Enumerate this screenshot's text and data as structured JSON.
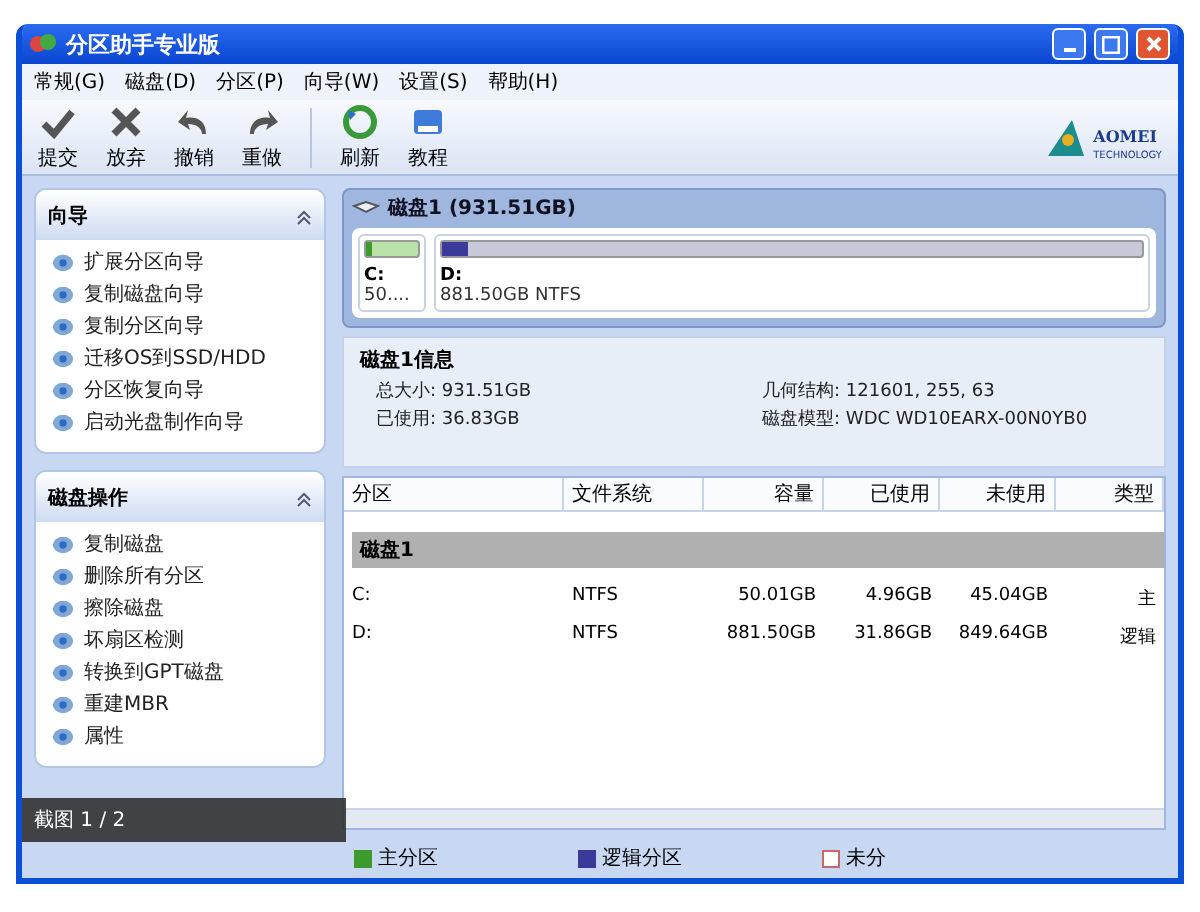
{
  "window": {
    "title": "分区助手专业版"
  },
  "menu": [
    {
      "label": "常规(G)"
    },
    {
      "label": "磁盘(D)"
    },
    {
      "label": "分区(P)"
    },
    {
      "label": "向导(W)"
    },
    {
      "label": "设置(S)"
    },
    {
      "label": "帮助(H)"
    }
  ],
  "toolbar": [
    {
      "label": "提交",
      "kind": "check"
    },
    {
      "label": "放弃",
      "kind": "cross"
    },
    {
      "label": "撤销",
      "kind": "undo"
    },
    {
      "label": "重做",
      "kind": "redo"
    },
    {
      "label": "刷新",
      "kind": "refresh"
    },
    {
      "label": "教程",
      "kind": "book"
    }
  ],
  "logo": {
    "name": "AOMEI",
    "sub": "TECHNOLOGY"
  },
  "sidebar": {
    "panels": [
      {
        "title": "向导",
        "expanded": true,
        "items": [
          {
            "label": "扩展分区向导"
          },
          {
            "label": "复制磁盘向导"
          },
          {
            "label": "复制分区向导"
          },
          {
            "label": "迁移OS到SSD/HDD"
          },
          {
            "label": "分区恢复向导"
          },
          {
            "label": "启动光盘制作向导"
          }
        ]
      },
      {
        "title": "磁盘操作",
        "expanded": true,
        "items": [
          {
            "label": "复制磁盘"
          },
          {
            "label": "删除所有分区"
          },
          {
            "label": "擦除磁盘"
          },
          {
            "label": "坏扇区检测"
          },
          {
            "label": "转换到GPT磁盘"
          },
          {
            "label": "重建MBR"
          },
          {
            "label": "属性"
          }
        ]
      }
    ]
  },
  "disk_map": {
    "title": "磁盘1 (931.51GB)",
    "partitions": [
      {
        "name": "C:",
        "detail": "50....",
        "kind": "primary",
        "level": 0.1
      },
      {
        "name": "D:",
        "detail": "881.50GB NTFS",
        "kind": "logical",
        "level": 0.036
      }
    ]
  },
  "disk_info": {
    "title": "磁盘1信息",
    "fields": [
      {
        "label": "总大小:",
        "value": "931.51GB"
      },
      {
        "label": "几何结构:",
        "value": "121601, 255, 63"
      },
      {
        "label": "已使用:",
        "value": "36.83GB"
      },
      {
        "label": "磁盘模型:",
        "value": "WDC WD10EARX-00N0YB0"
      }
    ]
  },
  "table": {
    "columns": [
      "分区",
      "文件系统",
      "容量",
      "已使用",
      "未使用",
      "类型"
    ],
    "groups": [
      {
        "name": "磁盘1",
        "rows": [
          [
            "C:",
            "NTFS",
            "50.01GB",
            "4.96GB",
            "45.04GB",
            "主"
          ],
          [
            "D:",
            "NTFS",
            "881.50GB",
            "31.86GB",
            "849.64GB",
            "逻辑"
          ]
        ]
      }
    ]
  },
  "legend": [
    {
      "label": "主分区",
      "kind": "primary"
    },
    {
      "label": "逻辑分区",
      "kind": "logical"
    },
    {
      "label": "未分",
      "kind": "unallocated"
    }
  ],
  "caption": "截图 1 / 2"
}
